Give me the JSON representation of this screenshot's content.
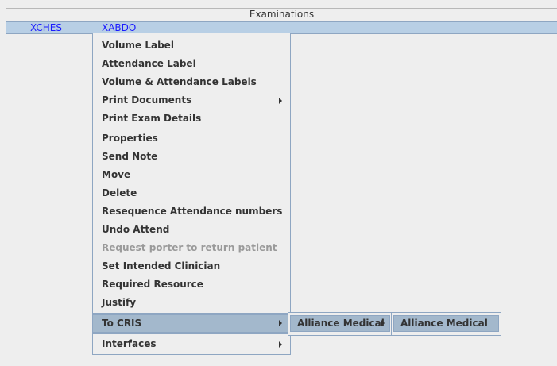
{
  "window": {
    "title": "Examinations"
  },
  "tabs": [
    {
      "label": "XCHES"
    },
    {
      "label": "XABDO"
    }
  ],
  "menu": {
    "items": [
      {
        "label": "Volume Label"
      },
      {
        "label": "Attendance Label"
      },
      {
        "label": "Volume & Attendance Labels"
      },
      {
        "label": "Print Documents",
        "has_submenu": true
      },
      {
        "label": "Print Exam Details"
      },
      {
        "label": "Properties"
      },
      {
        "label": "Send Note"
      },
      {
        "label": "Move"
      },
      {
        "label": "Delete"
      },
      {
        "label": "Resequence Attendance numbers"
      },
      {
        "label": "Undo Attend"
      },
      {
        "label": "Request porter to return patient",
        "disabled": true
      },
      {
        "label": "Set Intended Clinician"
      },
      {
        "label": "Required Resource"
      },
      {
        "label": "Justify"
      },
      {
        "label": "To CRIS",
        "has_submenu": true,
        "selected": true
      },
      {
        "label": "Interfaces",
        "has_submenu": true
      }
    ]
  },
  "submenu_cris": {
    "items": [
      {
        "label": "Alliance Medical",
        "has_submenu": true,
        "selected": true
      }
    ]
  },
  "submenu_alliance": {
    "items": [
      {
        "label": "Alliance Medical",
        "selected": true
      }
    ]
  },
  "colors": {
    "background": "#eeeeee",
    "tab_bar": "#b8cfe5",
    "selection": "#a3b8cc",
    "tab_text": "#1a1aff"
  }
}
